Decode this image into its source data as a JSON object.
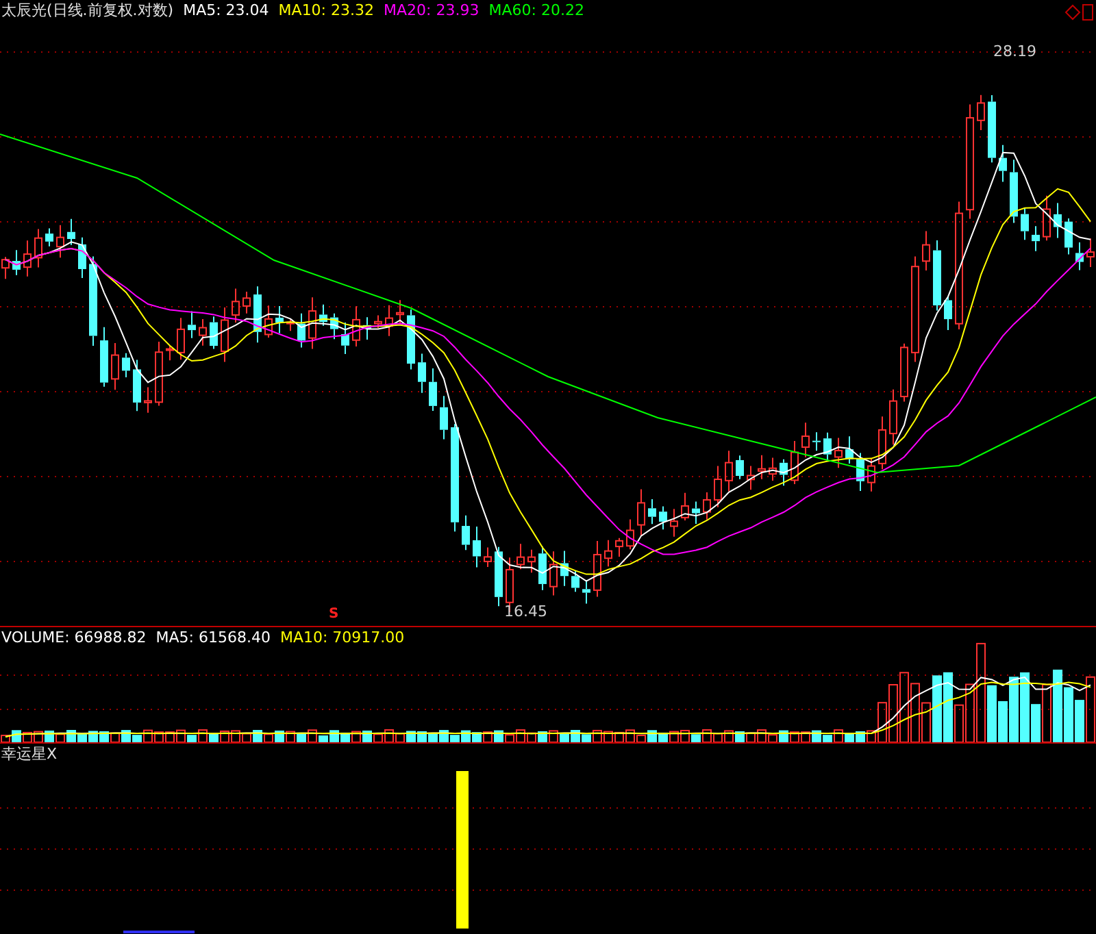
{
  "title": {
    "name": "太辰光(日线.前复权.对数)",
    "indicators": [
      {
        "label": "MA5: 23.04",
        "color": "#ffffff"
      },
      {
        "label": "MA10: 23.32",
        "color": "#ffff00"
      },
      {
        "label": "MA20: 23.93",
        "color": "#ff00ff"
      },
      {
        "label": "MA60: 20.22",
        "color": "#00ff00"
      }
    ]
  },
  "price_chart": {
    "high_label": "28.19",
    "low_label": "16.45",
    "signal": "S"
  },
  "volume": {
    "indicators": [
      {
        "label": "VOLUME: 66988.82",
        "color": "#ffffff"
      },
      {
        "label": "MA5: 61568.40",
        "color": "#ffffff"
      },
      {
        "label": "MA10: 70917.00",
        "color": "#ffff00"
      }
    ]
  },
  "indicator_panel": {
    "title": "幸运星X"
  }
}
